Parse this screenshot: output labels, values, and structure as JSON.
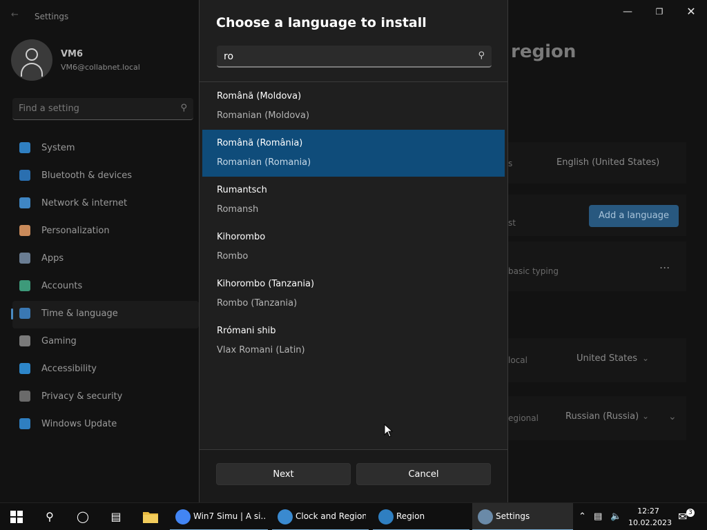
{
  "settings": {
    "window_title": "Settings",
    "user_name": "VM6",
    "user_email": "VM6@collabnet.local",
    "search_placeholder": "Find a setting",
    "nav": [
      {
        "label": "System",
        "color": "#2f7fc1"
      },
      {
        "label": "Bluetooth & devices",
        "color": "#2a6fb0"
      },
      {
        "label": "Network & internet",
        "color": "#3f86c4"
      },
      {
        "label": "Personalization",
        "color": "#c98a5a"
      },
      {
        "label": "Apps",
        "color": "#6a7d93"
      },
      {
        "label": "Accounts",
        "color": "#3d9a7a"
      },
      {
        "label": "Time & language",
        "color": "#3a78b3"
      },
      {
        "label": "Gaming",
        "color": "#7a7a7a"
      },
      {
        "label": "Accessibility",
        "color": "#2d86c9"
      },
      {
        "label": "Privacy & security",
        "color": "#6a6a6a"
      },
      {
        "label": "Windows Update",
        "color": "#2f7fc1"
      }
    ],
    "active_nav": "Time & language",
    "bg": {
      "heading_fragment": "region",
      "display_language_value": "English (United States)",
      "add_language_label": "Add a language",
      "row_fragment_1": "st",
      "row_fragment_2": "basic typing",
      "more_icon": "...",
      "row_fragment_3": "local",
      "country_value": "United States",
      "row_fragment_4": "egional",
      "format_value": "Russian (Russia)"
    }
  },
  "dialog": {
    "title": "Choose a language to install",
    "search_value": "ro",
    "languages": [
      {
        "native": "Română (Moldova)",
        "english": "Romanian (Moldova)",
        "selected": false
      },
      {
        "native": "Română (România)",
        "english": "Romanian (Romania)",
        "selected": true
      },
      {
        "native": "Rumantsch",
        "english": "Romansh",
        "selected": false
      },
      {
        "native": "Kihorombo",
        "english": "Rombo",
        "selected": false
      },
      {
        "native": "Kihorombo (Tanzania)",
        "english": "Rombo (Tanzania)",
        "selected": false
      },
      {
        "native": "Rrómani shib",
        "english": "Vlax Romani (Latin)",
        "selected": false
      }
    ],
    "next_label": "Next",
    "cancel_label": "Cancel"
  },
  "taskbar": {
    "apps": [
      {
        "label": "Win7 Simu | A si...",
        "icon": "chrome-icon"
      },
      {
        "label": "Clock and Region",
        "icon": "clock-region-icon"
      },
      {
        "label": "Region",
        "icon": "globe-icon"
      },
      {
        "label": "Settings",
        "icon": "gear-icon"
      }
    ],
    "time": "12:27",
    "date": "10.02.2023",
    "notification_count": "3"
  }
}
